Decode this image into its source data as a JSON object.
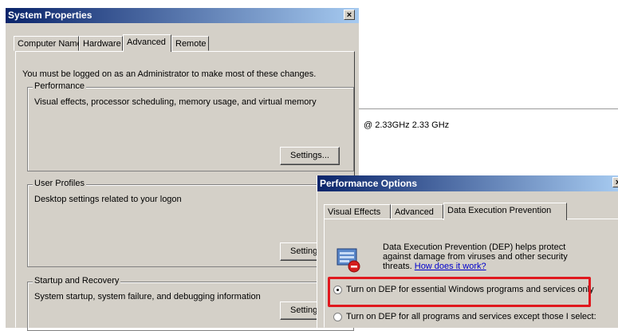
{
  "background_window": {
    "cpu_text": "@ 2.33GHz   2.33 GHz"
  },
  "system_properties": {
    "title": "System Properties",
    "close_label": "×",
    "tabs": [
      {
        "label": "Computer Name"
      },
      {
        "label": "Hardware"
      },
      {
        "label": "Advanced",
        "active": true
      },
      {
        "label": "Remote"
      }
    ],
    "admin_note": "You must be logged on as an Administrator to make most of these changes.",
    "groups": {
      "performance": {
        "label": "Performance",
        "description": "Visual effects, processor scheduling, memory usage, and virtual memory",
        "button": "Settings..."
      },
      "user_profiles": {
        "label": "User Profiles",
        "description": "Desktop settings related to your logon",
        "button": "Settings..."
      },
      "startup_recovery": {
        "label": "Startup and Recovery",
        "description": "System startup, system failure, and debugging information",
        "button": "Settings..."
      }
    }
  },
  "performance_options": {
    "title": "Performance Options",
    "close_label": "×",
    "tabs": [
      {
        "label": "Visual Effects"
      },
      {
        "label": "Advanced"
      },
      {
        "label": "Data Execution Prevention",
        "active": true
      }
    ],
    "dep_description": "Data Execution Prevention (DEP) helps protect against damage from viruses and other security threats.",
    "dep_link": "How does it work?",
    "options": [
      {
        "label": "Turn on DEP for essential Windows programs and services only",
        "selected": true
      },
      {
        "label": "Turn on DEP for all programs and services except those I select:",
        "selected": false
      }
    ]
  },
  "colors": {
    "titlebar_start": "#0a246a",
    "titlebar_end": "#a6caf0",
    "dialog_face": "#d4d0c8",
    "highlight_box": "#e0181e",
    "link": "#0000cc"
  }
}
